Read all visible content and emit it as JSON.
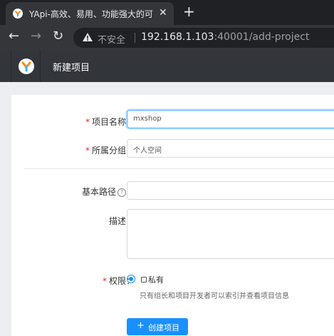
{
  "browser": {
    "tab_title": "YApi-高效、易用、功能强大的可",
    "tab_close": "✕",
    "new_tab": "+",
    "back": "←",
    "forward": "→",
    "reload": "↻",
    "insecure_label": "不安全",
    "url_host": "192.168.1.103",
    "url_rest": ":40001/add-project"
  },
  "app": {
    "page_title": "新建项目"
  },
  "form": {
    "name_label": "项目名称",
    "name_value": "mxshop",
    "group_label": "所属分组",
    "group_value": "个人空间",
    "basepath_label": "基本路径",
    "basepath_help": "?",
    "desc_label": "描述",
    "permission_label": "权限",
    "permission_option": "私有",
    "permission_hint": "只有组长和项目开发者可以索引并查看项目信息",
    "required_mark": "*",
    "colon": "：",
    "submit_plus": "+",
    "submit_label": "创建项目"
  },
  "colors": {
    "primary": "#1890ff",
    "required": "#f5222d",
    "header": "#32363a"
  }
}
